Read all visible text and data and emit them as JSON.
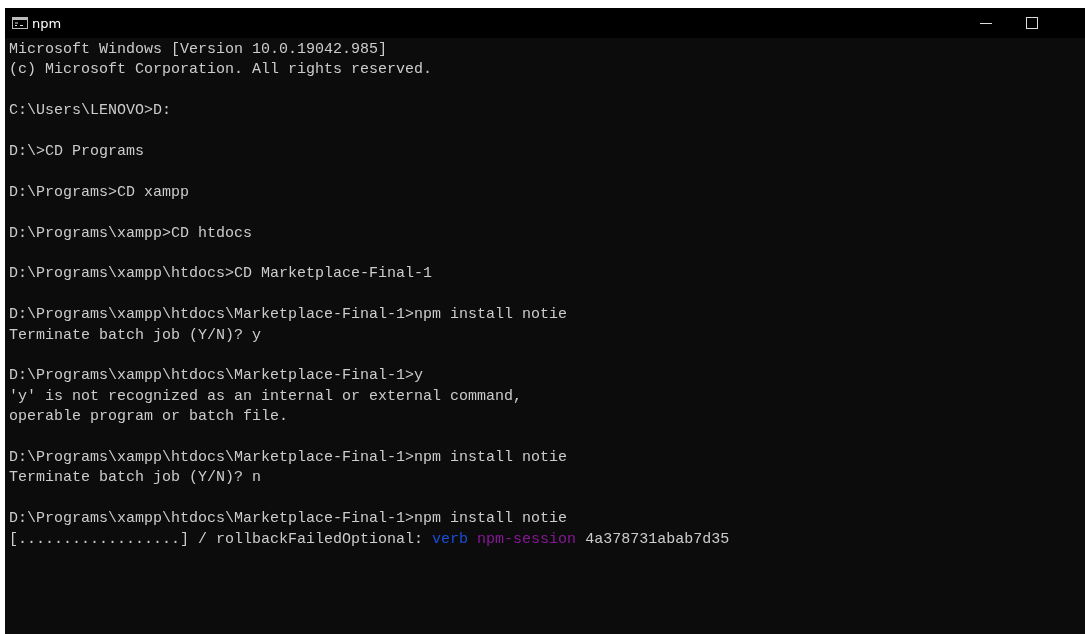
{
  "window": {
    "title": "npm"
  },
  "console": {
    "groups": [
      [
        {
          "kind": "plain",
          "text": "Microsoft Windows [Version 10.0.19042.985]"
        },
        {
          "kind": "plain",
          "text": "(c) Microsoft Corporation. All rights reserved."
        }
      ],
      [
        {
          "kind": "plain",
          "text": "C:\\Users\\LENOVO>D:"
        }
      ],
      [
        {
          "kind": "plain",
          "text": "D:\\>CD Programs"
        }
      ],
      [
        {
          "kind": "plain",
          "text": "D:\\Programs>CD xampp"
        }
      ],
      [
        {
          "kind": "plain",
          "text": "D:\\Programs\\xampp>CD htdocs"
        }
      ],
      [
        {
          "kind": "plain",
          "text": "D:\\Programs\\xampp\\htdocs>CD Marketplace-Final-1"
        }
      ],
      [
        {
          "kind": "plain",
          "text": "D:\\Programs\\xampp\\htdocs\\Marketplace-Final-1>npm install notie"
        },
        {
          "kind": "plain",
          "text": "Terminate batch job (Y/N)? y"
        }
      ],
      [
        {
          "kind": "plain",
          "text": "D:\\Programs\\xampp\\htdocs\\Marketplace-Final-1>y"
        },
        {
          "kind": "plain",
          "text": "'y' is not recognized as an internal or external command,"
        },
        {
          "kind": "plain",
          "text": "operable program or batch file."
        }
      ],
      [
        {
          "kind": "plain",
          "text": "D:\\Programs\\xampp\\htdocs\\Marketplace-Final-1>npm install notie"
        },
        {
          "kind": "plain",
          "text": "Terminate batch job (Y/N)? n"
        }
      ],
      [
        {
          "kind": "plain",
          "text": "D:\\Programs\\xampp\\htdocs\\Marketplace-Final-1>npm install notie"
        },
        {
          "kind": "segments",
          "segments": [
            {
              "text": "[..................] / rollbackFailedOptional:",
              "color": "#cccccc"
            },
            {
              "text": "verb",
              "color": "#1a4ed8"
            },
            {
              "text": "npm-session",
              "color": "#881798"
            },
            {
              "text": "4a378731abab7d35",
              "color": "#cccccc"
            }
          ]
        }
      ]
    ]
  }
}
